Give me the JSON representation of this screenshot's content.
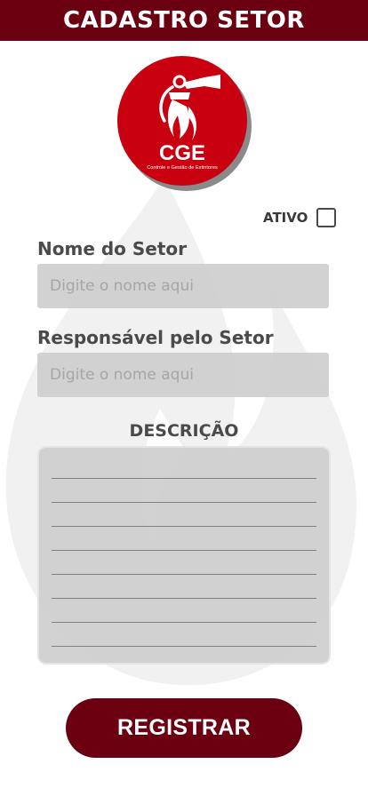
{
  "header": {
    "title": "CADASTRO SETOR"
  },
  "logo": {
    "brand": "CGE",
    "tagline": "Controle e Gestão de Extintores"
  },
  "ativo": {
    "label": "ATIVO",
    "checked": false
  },
  "form": {
    "nome_label": "Nome do Setor",
    "nome_placeholder": "Digite o nome aqui",
    "nome_value": "",
    "responsavel_label": "Responsável pelo Setor",
    "responsavel_placeholder": "Digite o nome aqui",
    "responsavel_value": "",
    "descricao_label": "DESCRIÇÃO",
    "descricao_value": ""
  },
  "actions": {
    "register_label": "REGISTRAR"
  },
  "colors": {
    "brand_dark": "#6b0010",
    "logo_red": "#c8000f",
    "field_gray": "#cdcdcd"
  }
}
